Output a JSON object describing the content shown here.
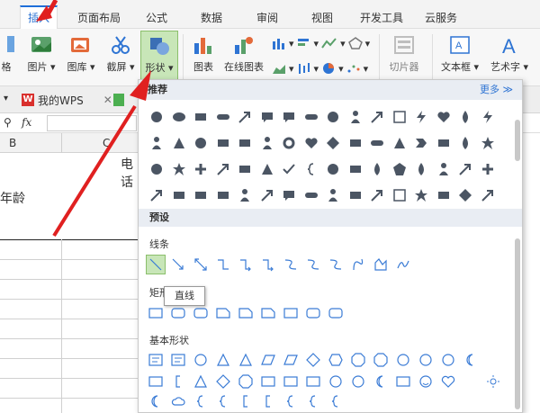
{
  "tabs": [
    "插入",
    "页面布局",
    "公式",
    "数据",
    "审阅",
    "视图",
    "开发工具",
    "云服务"
  ],
  "ribbon": {
    "partial_label": "格",
    "picture": "图片",
    "gallery": "图库",
    "screenshot": "截屏",
    "shapes": "形状",
    "chart": "图表",
    "online_chart": "在线图表",
    "slicer": "切片器",
    "textbox": "文本框",
    "wordart": "艺术字"
  },
  "docbar": {
    "tab_label": "我的WPS"
  },
  "formula": {
    "fx": "fx"
  },
  "sheet": {
    "col_b": "B",
    "col_c": "C",
    "cell_phone": "电话",
    "cell_age": "年龄"
  },
  "panel": {
    "recommended": "推荐",
    "more": "更多",
    "presets": "预设",
    "lines": "线条",
    "rectangles": "矩形",
    "basic_shapes": "基本形状",
    "tooltip": "直线"
  },
  "icons": {
    "accent": "#2e74d3",
    "shape_fill": "#4b5563",
    "line": "#3a7bd5"
  }
}
